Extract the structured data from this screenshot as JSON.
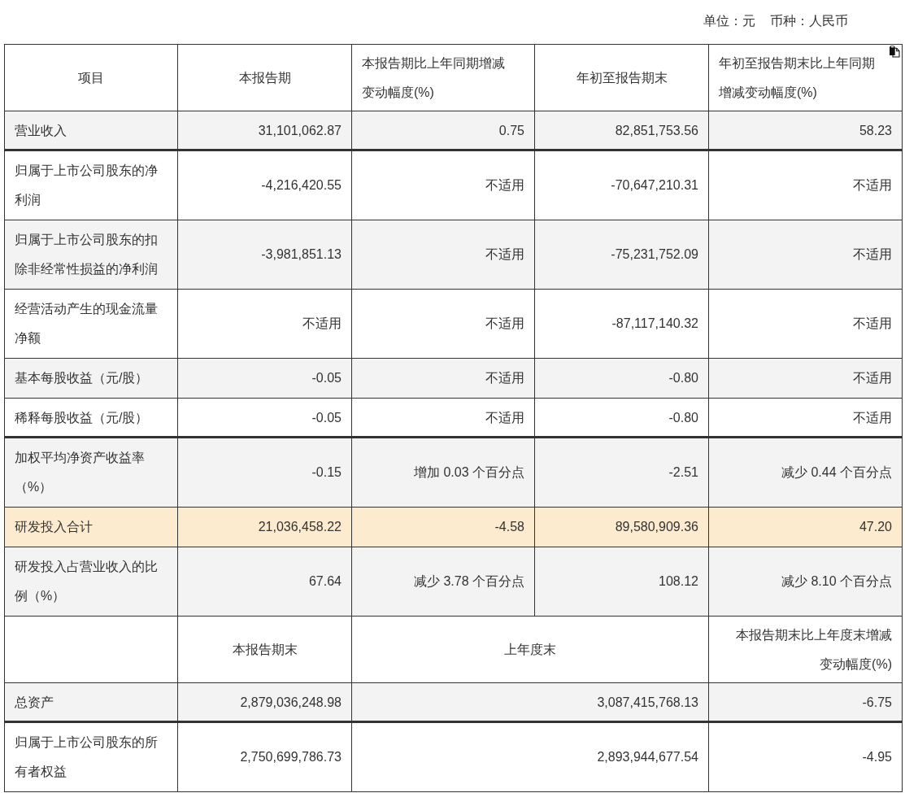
{
  "unit_labels": [
    "单位：元",
    "币种：人民币"
  ],
  "table1": {
    "columns": [
      "项目",
      "本报告期",
      "本报告期比上年同期增减变动幅度(%)",
      "年初至报告期末",
      "年初至报告期末比上年同期增减变动幅度(%)"
    ],
    "rows": [
      {
        "cells": [
          "营业收入",
          "31,101,062.87",
          "0.75",
          "82,851,753.56",
          "58.23"
        ],
        "highlighted": false,
        "rule_below": true
      },
      {
        "cells": [
          "归属于上市公司股东的净利润",
          "-4,216,420.55",
          "不适用",
          "-70,647,210.31",
          "不适用"
        ],
        "highlighted": false,
        "rule_below": false
      },
      {
        "cells": [
          "归属于上市公司股东的扣除非经常性损益的净利润",
          "-3,981,851.13",
          "不适用",
          "-75,231,752.09",
          "不适用"
        ],
        "highlighted": false,
        "rule_below": false
      },
      {
        "cells": [
          "经营活动产生的现金流量净额",
          "不适用",
          "不适用",
          "-87,117,140.32",
          "不适用"
        ],
        "highlighted": false,
        "rule_below": false
      },
      {
        "cells": [
          "基本每股收益（元/股）",
          "-0.05",
          "不适用",
          "-0.80",
          "不适用"
        ],
        "highlighted": false,
        "rule_below": false
      },
      {
        "cells": [
          "稀释每股收益（元/股）",
          "-0.05",
          "不适用",
          "-0.80",
          "不适用"
        ],
        "highlighted": false,
        "rule_below": true
      },
      {
        "cells": [
          "加权平均净资产收益率（%）",
          "-0.15",
          "增加 0.03 个百分点",
          "-2.51",
          "减少 0.44 个百分点"
        ],
        "highlighted": false,
        "rule_below": false
      },
      {
        "cells": [
          "研发投入合计",
          "21,036,458.22",
          "-4.58",
          "89,580,909.36",
          "47.20"
        ],
        "highlighted": true,
        "rule_below": false
      },
      {
        "cells": [
          "研发投入占营业收入的比例（%）",
          "67.64",
          "减少 3.78 个百分点",
          "108.12",
          "减少 8.10 个百分点"
        ],
        "highlighted": false,
        "rule_below": false
      }
    ]
  },
  "table2": {
    "columns": [
      "",
      "本报告期末",
      "上年度末",
      "本报告期末比上年度末增减变动幅度(%)"
    ],
    "rows": [
      {
        "cells": [
          "总资产",
          "2,879,036,248.98",
          "3,087,415,768.13",
          "-6.75"
        ],
        "highlighted": false,
        "rule_below": true
      },
      {
        "cells": [
          "归属于上市公司股东的所有者权益",
          "2,750,699,786.73",
          "2,893,944,677.54",
          "-4.95"
        ],
        "highlighted": false,
        "rule_below": false
      }
    ]
  }
}
